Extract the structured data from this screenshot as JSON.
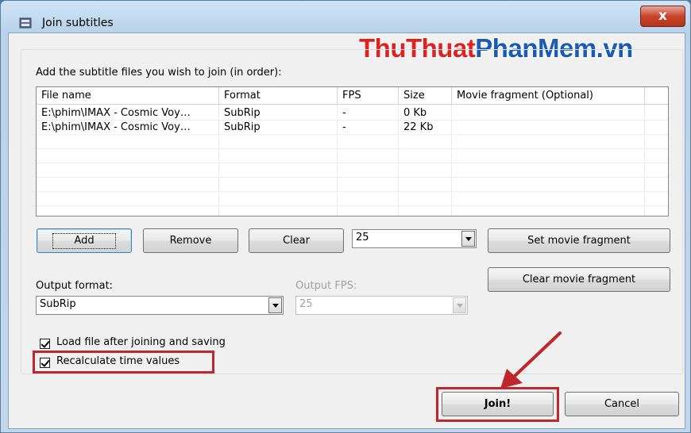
{
  "window": {
    "title": "Join subtitles",
    "close_symbol": "x"
  },
  "watermark": {
    "part1": "ThuThuat",
    "part2": "PhanMem.vn"
  },
  "instructions": "Add the subtitle files you wish to join (in order):",
  "table": {
    "columns": [
      "File name",
      "Format",
      "FPS",
      "Size",
      "Movie fragment (Optional)"
    ],
    "rows": [
      {
        "file": "E:\\phim\\IMAX - Cosmic Voy…",
        "format": "SubRip",
        "fps": "-",
        "size": "0 Kb",
        "fragment": ""
      },
      {
        "file": "E:\\phim\\IMAX - Cosmic Voy…",
        "format": "SubRip",
        "fps": "-",
        "size": "22 Kb",
        "fragment": ""
      }
    ]
  },
  "buttons": {
    "add": "Add",
    "remove": "Remove",
    "clear": "Clear",
    "set_fragment": "Set movie fragment",
    "clear_fragment": "Clear movie fragment",
    "join": "Join!",
    "cancel": "Cancel"
  },
  "fps_combo": {
    "value": "25"
  },
  "output_format": {
    "label": "Output format:",
    "value": "SubRip"
  },
  "output_fps": {
    "label": "Output FPS:",
    "value": "25",
    "enabled": false
  },
  "checkboxes": {
    "load_file": {
      "label": "Load file after joining and saving",
      "checked": true
    },
    "recalculate": {
      "label": "Recalculate time values",
      "checked": true
    }
  },
  "colors": {
    "annotation": "#c0272d",
    "watermark_red": "#e0211f",
    "watermark_blue": "#1a5bb4"
  }
}
